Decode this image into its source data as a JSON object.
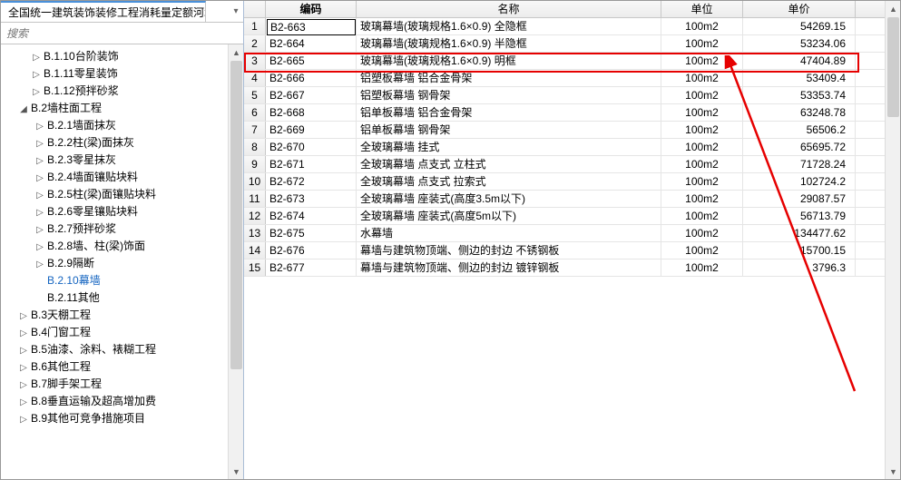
{
  "tab_title": "全国统一建筑装饰装修工程消耗量定额河北省消",
  "search_placeholder": "搜索",
  "tree": [
    {
      "indent": 1,
      "toggle": "▷",
      "label": "B.1.10台阶装饰"
    },
    {
      "indent": 1,
      "toggle": "▷",
      "label": "B.1.11零星装饰"
    },
    {
      "indent": 1,
      "toggle": "▷",
      "label": "B.1.12预拌砂浆"
    },
    {
      "indent": 2,
      "toggle": "◢",
      "label": "B.2墙柱面工程"
    },
    {
      "indent": 3,
      "toggle": "▷",
      "label": "B.2.1墙面抹灰"
    },
    {
      "indent": 3,
      "toggle": "▷",
      "label": "B.2.2柱(梁)面抹灰"
    },
    {
      "indent": 3,
      "toggle": "▷",
      "label": "B.2.3零星抹灰"
    },
    {
      "indent": 3,
      "toggle": "▷",
      "label": "B.2.4墙面镶贴块料"
    },
    {
      "indent": 3,
      "toggle": "▷",
      "label": "B.2.5柱(梁)面镶贴块料"
    },
    {
      "indent": 3,
      "toggle": "▷",
      "label": "B.2.6零星镶贴块料"
    },
    {
      "indent": 3,
      "toggle": "▷",
      "label": "B.2.7预拌砂浆"
    },
    {
      "indent": 3,
      "toggle": "▷",
      "label": "B.2.8墙、柱(梁)饰面"
    },
    {
      "indent": 3,
      "toggle": "▷",
      "label": "B.2.9隔断"
    },
    {
      "indent": 3,
      "toggle": "",
      "label": "B.2.10幕墙",
      "selected": true
    },
    {
      "indent": 3,
      "toggle": "",
      "label": "B.2.11其他"
    },
    {
      "indent": 2,
      "toggle": "▷",
      "label": "B.3天棚工程"
    },
    {
      "indent": 2,
      "toggle": "▷",
      "label": "B.4门窗工程"
    },
    {
      "indent": 2,
      "toggle": "▷",
      "label": "B.5油漆、涂料、裱糊工程"
    },
    {
      "indent": 2,
      "toggle": "▷",
      "label": "B.6其他工程"
    },
    {
      "indent": 2,
      "toggle": "▷",
      "label": "B.7脚手架工程"
    },
    {
      "indent": 2,
      "toggle": "▷",
      "label": "B.8垂直运输及超高增加费"
    },
    {
      "indent": 2,
      "toggle": "▷",
      "label": "B.9其他可竞争措施项目"
    }
  ],
  "grid_headers": {
    "code": "编码",
    "name": "名称",
    "unit": "单位",
    "price": "单价"
  },
  "code_input_value": "B2-663",
  "rows": [
    {
      "idx": "1",
      "code": "B2-663",
      "name": "玻璃幕墙(玻璃规格1.6×0.9) 全隐框",
      "unit": "100m2",
      "price": "54269.15"
    },
    {
      "idx": "2",
      "code": "B2-664",
      "name": "玻璃幕墙(玻璃规格1.6×0.9) 半隐框",
      "unit": "100m2",
      "price": "53234.06"
    },
    {
      "idx": "3",
      "code": "B2-665",
      "name": "玻璃幕墙(玻璃规格1.6×0.9) 明框",
      "unit": "100m2",
      "price": "47404.89"
    },
    {
      "idx": "4",
      "code": "B2-666",
      "name": "铝塑板幕墙 铝合金骨架",
      "unit": "100m2",
      "price": "53409.4"
    },
    {
      "idx": "5",
      "code": "B2-667",
      "name": "铝塑板幕墙 钢骨架",
      "unit": "100m2",
      "price": "53353.74"
    },
    {
      "idx": "6",
      "code": "B2-668",
      "name": "铝单板幕墙 铝合金骨架",
      "unit": "100m2",
      "price": "63248.78"
    },
    {
      "idx": "7",
      "code": "B2-669",
      "name": "铝单板幕墙 钢骨架",
      "unit": "100m2",
      "price": "56506.2"
    },
    {
      "idx": "8",
      "code": "B2-670",
      "name": "全玻璃幕墙 挂式",
      "unit": "100m2",
      "price": "65695.72"
    },
    {
      "idx": "9",
      "code": "B2-671",
      "name": "全玻璃幕墙 点支式 立柱式",
      "unit": "100m2",
      "price": "71728.24"
    },
    {
      "idx": "10",
      "code": "B2-672",
      "name": "全玻璃幕墙 点支式 拉索式",
      "unit": "100m2",
      "price": "102724.2"
    },
    {
      "idx": "11",
      "code": "B2-673",
      "name": "全玻璃幕墙 座装式(高度3.5m以下)",
      "unit": "100m2",
      "price": "29087.57"
    },
    {
      "idx": "12",
      "code": "B2-674",
      "name": "全玻璃幕墙 座装式(高度5m以下)",
      "unit": "100m2",
      "price": "56713.79"
    },
    {
      "idx": "13",
      "code": "B2-675",
      "name": "水幕墙",
      "unit": "100m2",
      "price": "134477.62"
    },
    {
      "idx": "14",
      "code": "B2-676",
      "name": "幕墙与建筑物顶端、侧边的封边 不锈钢板",
      "unit": "100m2",
      "price": "15700.15"
    },
    {
      "idx": "15",
      "code": "B2-677",
      "name": "幕墙与建筑物顶端、侧边的封边 镀锌钢板",
      "unit": "100m2",
      "price": "3796.3"
    }
  ]
}
